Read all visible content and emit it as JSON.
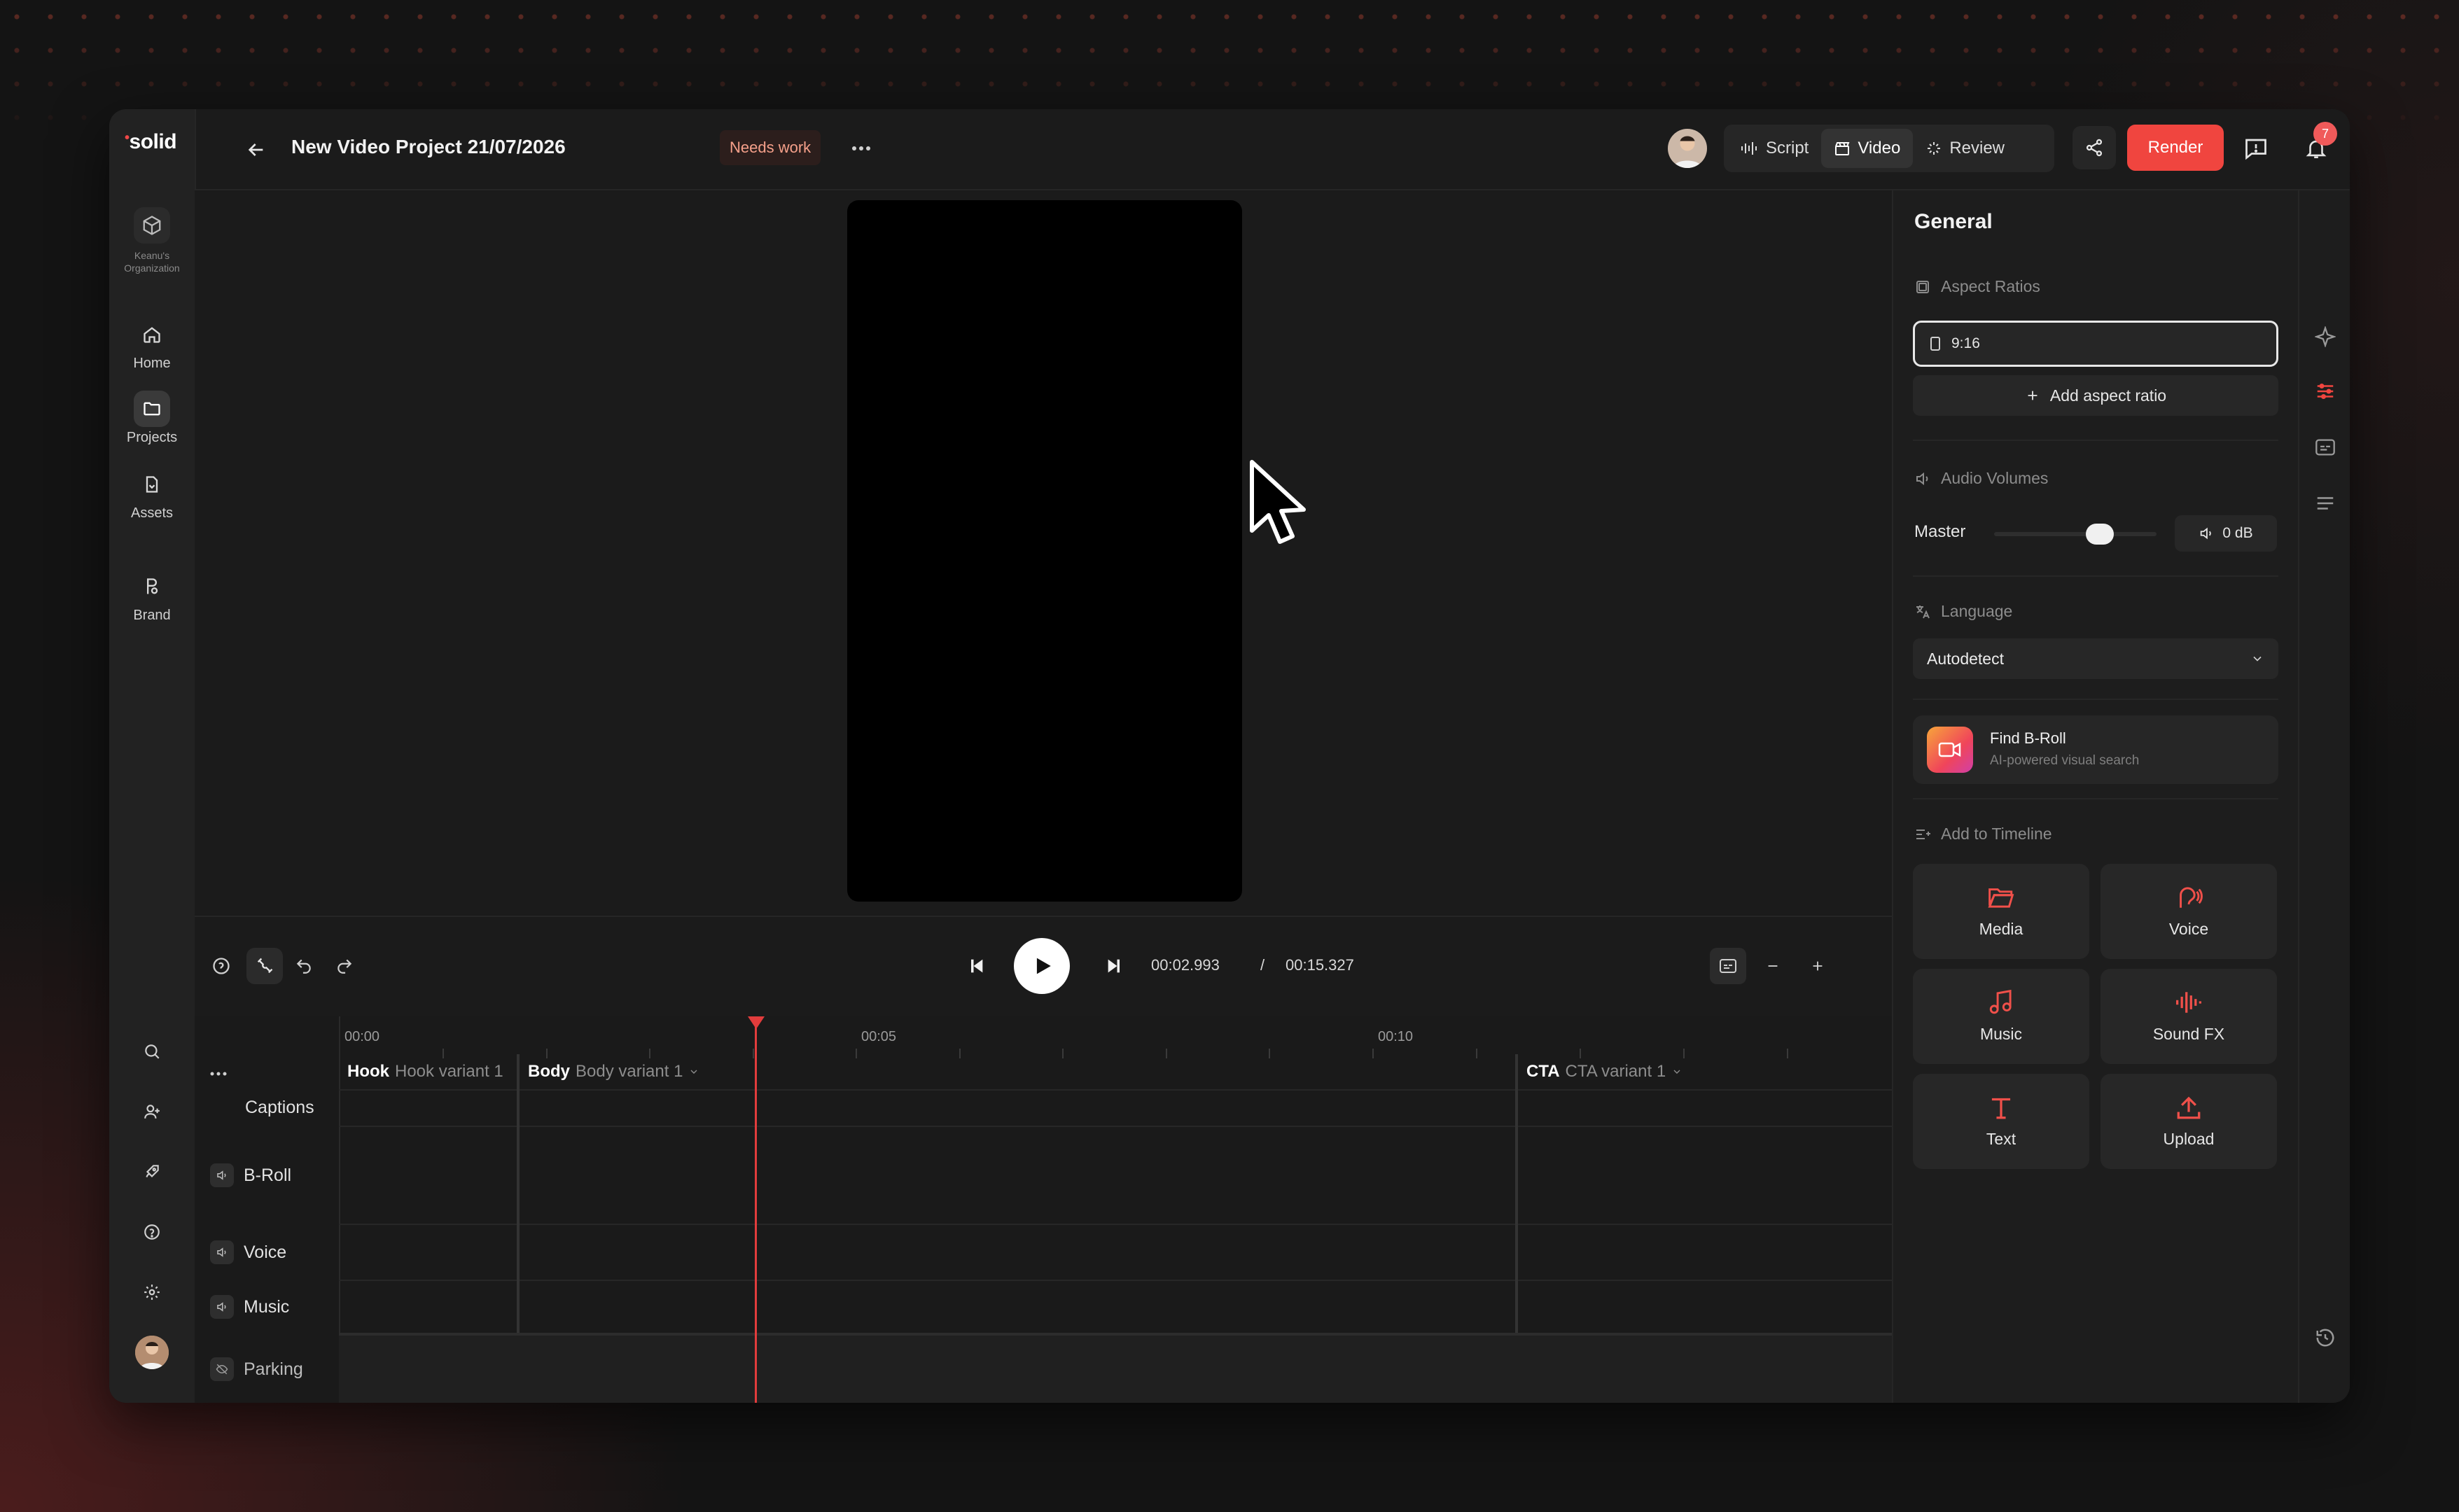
{
  "app": {
    "logo": "solid"
  },
  "org": {
    "label": "Keanu's Organization"
  },
  "nav": [
    {
      "label": "Home",
      "icon": "home-icon"
    },
    {
      "label": "Projects",
      "icon": "folder-icon",
      "active": true
    },
    {
      "label": "Assets",
      "icon": "file-icon"
    },
    {
      "label": "Brand",
      "icon": "palette-icon"
    }
  ],
  "header": {
    "title": "New Video Project 21/07/2026",
    "status": "Needs work",
    "modes": [
      "Script",
      "Video",
      "Review"
    ],
    "active_mode": "Video",
    "render_label": "Render",
    "notification_count": "7"
  },
  "transport": {
    "current_time": "00:02.993",
    "separator": "/",
    "total_time": "00:15.327"
  },
  "timeline": {
    "ticks": [
      "00:00",
      "00:05",
      "00:10"
    ],
    "segments": [
      {
        "name": "Hook",
        "variant": "Hook variant 1"
      },
      {
        "name": "Body",
        "variant": "Body variant 1"
      },
      {
        "name": "CTA",
        "variant": "CTA variant 1"
      }
    ],
    "tracks": [
      "Captions",
      "B-Roll",
      "Voice",
      "Music",
      "Parking"
    ],
    "more_label": "..."
  },
  "panel": {
    "title": "General",
    "aspect_ratios_label": "Aspect Ratios",
    "aspect_ratio_value": "9:16",
    "add_aspect_ratio": "Add aspect ratio",
    "audio_volumes_label": "Audio Volumes",
    "master_label": "Master",
    "master_volume": 0.65,
    "master_db": "0 dB",
    "language_label": "Language",
    "language_value": "Autodetect",
    "broll": {
      "title": "Find B-Roll",
      "subtitle": "AI-powered visual search"
    },
    "add_to_timeline_label": "Add to Timeline",
    "tiles": [
      "Media",
      "Voice",
      "Music",
      "Sound FX",
      "Text",
      "Upload"
    ]
  },
  "colors": {
    "accent": "#f0453f",
    "playhead": "#e23c3c",
    "status_text": "#f5a08a"
  }
}
